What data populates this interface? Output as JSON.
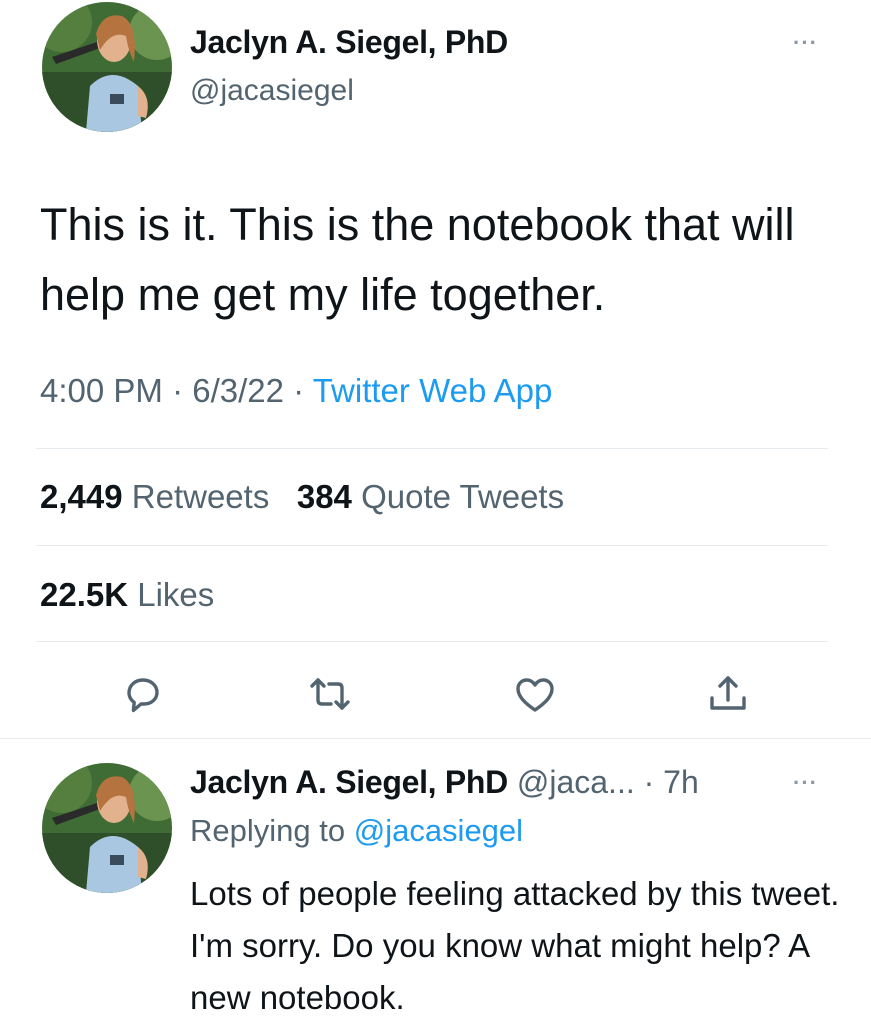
{
  "tweet": {
    "author_name": "Jaclyn A. Siegel, PhD",
    "author_handle": "@jacasiegel",
    "more_label": "···",
    "text": "This is it. This is the notebook that will help me get my life together.",
    "time": "4:00 PM",
    "sep": " · ",
    "date": "6/3/22",
    "source": "Twitter Web App",
    "retweets_count": "2,449",
    "retweets_label": "Retweets",
    "quotes_count": "384",
    "quotes_label": "Quote Tweets",
    "likes_count": "22.5K",
    "likes_label": "Likes"
  },
  "actions": {
    "icons": [
      "reply-icon",
      "retweet-icon",
      "like-icon",
      "share-icon"
    ],
    "color": "#536471"
  },
  "reply": {
    "author_name": "Jaclyn A. Siegel, PhD",
    "author_handle": "@jaca...",
    "time": "· 7h",
    "more_label": "···",
    "replying_prefix": "Replying to",
    "replying_to": "@jacasiegel",
    "text": "Lots of people feeling attacked by this tweet. I'm sorry. Do you know what might help? A new notebook."
  },
  "colors": {
    "link": "#1d9bf0",
    "secondary": "#536471",
    "text": "#0f1419"
  }
}
